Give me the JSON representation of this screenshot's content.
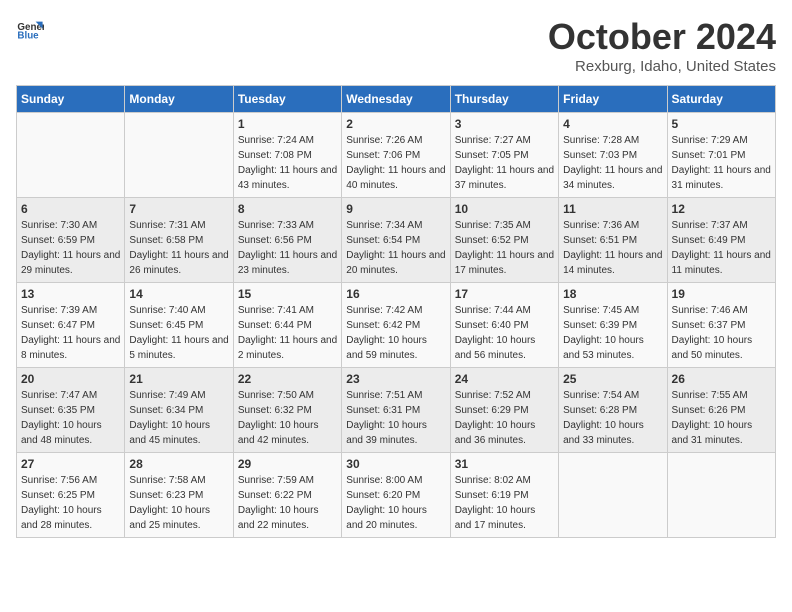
{
  "header": {
    "logo_general": "General",
    "logo_blue": "Blue",
    "month": "October 2024",
    "location": "Rexburg, Idaho, United States"
  },
  "days_of_week": [
    "Sunday",
    "Monday",
    "Tuesday",
    "Wednesday",
    "Thursday",
    "Friday",
    "Saturday"
  ],
  "weeks": [
    [
      {
        "day": "",
        "sunrise": "",
        "sunset": "",
        "daylight": ""
      },
      {
        "day": "",
        "sunrise": "",
        "sunset": "",
        "daylight": ""
      },
      {
        "day": "1",
        "sunrise": "Sunrise: 7:24 AM",
        "sunset": "Sunset: 7:08 PM",
        "daylight": "Daylight: 11 hours and 43 minutes."
      },
      {
        "day": "2",
        "sunrise": "Sunrise: 7:26 AM",
        "sunset": "Sunset: 7:06 PM",
        "daylight": "Daylight: 11 hours and 40 minutes."
      },
      {
        "day": "3",
        "sunrise": "Sunrise: 7:27 AM",
        "sunset": "Sunset: 7:05 PM",
        "daylight": "Daylight: 11 hours and 37 minutes."
      },
      {
        "day": "4",
        "sunrise": "Sunrise: 7:28 AM",
        "sunset": "Sunset: 7:03 PM",
        "daylight": "Daylight: 11 hours and 34 minutes."
      },
      {
        "day": "5",
        "sunrise": "Sunrise: 7:29 AM",
        "sunset": "Sunset: 7:01 PM",
        "daylight": "Daylight: 11 hours and 31 minutes."
      }
    ],
    [
      {
        "day": "6",
        "sunrise": "Sunrise: 7:30 AM",
        "sunset": "Sunset: 6:59 PM",
        "daylight": "Daylight: 11 hours and 29 minutes."
      },
      {
        "day": "7",
        "sunrise": "Sunrise: 7:31 AM",
        "sunset": "Sunset: 6:58 PM",
        "daylight": "Daylight: 11 hours and 26 minutes."
      },
      {
        "day": "8",
        "sunrise": "Sunrise: 7:33 AM",
        "sunset": "Sunset: 6:56 PM",
        "daylight": "Daylight: 11 hours and 23 minutes."
      },
      {
        "day": "9",
        "sunrise": "Sunrise: 7:34 AM",
        "sunset": "Sunset: 6:54 PM",
        "daylight": "Daylight: 11 hours and 20 minutes."
      },
      {
        "day": "10",
        "sunrise": "Sunrise: 7:35 AM",
        "sunset": "Sunset: 6:52 PM",
        "daylight": "Daylight: 11 hours and 17 minutes."
      },
      {
        "day": "11",
        "sunrise": "Sunrise: 7:36 AM",
        "sunset": "Sunset: 6:51 PM",
        "daylight": "Daylight: 11 hours and 14 minutes."
      },
      {
        "day": "12",
        "sunrise": "Sunrise: 7:37 AM",
        "sunset": "Sunset: 6:49 PM",
        "daylight": "Daylight: 11 hours and 11 minutes."
      }
    ],
    [
      {
        "day": "13",
        "sunrise": "Sunrise: 7:39 AM",
        "sunset": "Sunset: 6:47 PM",
        "daylight": "Daylight: 11 hours and 8 minutes."
      },
      {
        "day": "14",
        "sunrise": "Sunrise: 7:40 AM",
        "sunset": "Sunset: 6:45 PM",
        "daylight": "Daylight: 11 hours and 5 minutes."
      },
      {
        "day": "15",
        "sunrise": "Sunrise: 7:41 AM",
        "sunset": "Sunset: 6:44 PM",
        "daylight": "Daylight: 11 hours and 2 minutes."
      },
      {
        "day": "16",
        "sunrise": "Sunrise: 7:42 AM",
        "sunset": "Sunset: 6:42 PM",
        "daylight": "Daylight: 10 hours and 59 minutes."
      },
      {
        "day": "17",
        "sunrise": "Sunrise: 7:44 AM",
        "sunset": "Sunset: 6:40 PM",
        "daylight": "Daylight: 10 hours and 56 minutes."
      },
      {
        "day": "18",
        "sunrise": "Sunrise: 7:45 AM",
        "sunset": "Sunset: 6:39 PM",
        "daylight": "Daylight: 10 hours and 53 minutes."
      },
      {
        "day": "19",
        "sunrise": "Sunrise: 7:46 AM",
        "sunset": "Sunset: 6:37 PM",
        "daylight": "Daylight: 10 hours and 50 minutes."
      }
    ],
    [
      {
        "day": "20",
        "sunrise": "Sunrise: 7:47 AM",
        "sunset": "Sunset: 6:35 PM",
        "daylight": "Daylight: 10 hours and 48 minutes."
      },
      {
        "day": "21",
        "sunrise": "Sunrise: 7:49 AM",
        "sunset": "Sunset: 6:34 PM",
        "daylight": "Daylight: 10 hours and 45 minutes."
      },
      {
        "day": "22",
        "sunrise": "Sunrise: 7:50 AM",
        "sunset": "Sunset: 6:32 PM",
        "daylight": "Daylight: 10 hours and 42 minutes."
      },
      {
        "day": "23",
        "sunrise": "Sunrise: 7:51 AM",
        "sunset": "Sunset: 6:31 PM",
        "daylight": "Daylight: 10 hours and 39 minutes."
      },
      {
        "day": "24",
        "sunrise": "Sunrise: 7:52 AM",
        "sunset": "Sunset: 6:29 PM",
        "daylight": "Daylight: 10 hours and 36 minutes."
      },
      {
        "day": "25",
        "sunrise": "Sunrise: 7:54 AM",
        "sunset": "Sunset: 6:28 PM",
        "daylight": "Daylight: 10 hours and 33 minutes."
      },
      {
        "day": "26",
        "sunrise": "Sunrise: 7:55 AM",
        "sunset": "Sunset: 6:26 PM",
        "daylight": "Daylight: 10 hours and 31 minutes."
      }
    ],
    [
      {
        "day": "27",
        "sunrise": "Sunrise: 7:56 AM",
        "sunset": "Sunset: 6:25 PM",
        "daylight": "Daylight: 10 hours and 28 minutes."
      },
      {
        "day": "28",
        "sunrise": "Sunrise: 7:58 AM",
        "sunset": "Sunset: 6:23 PM",
        "daylight": "Daylight: 10 hours and 25 minutes."
      },
      {
        "day": "29",
        "sunrise": "Sunrise: 7:59 AM",
        "sunset": "Sunset: 6:22 PM",
        "daylight": "Daylight: 10 hours and 22 minutes."
      },
      {
        "day": "30",
        "sunrise": "Sunrise: 8:00 AM",
        "sunset": "Sunset: 6:20 PM",
        "daylight": "Daylight: 10 hours and 20 minutes."
      },
      {
        "day": "31",
        "sunrise": "Sunrise: 8:02 AM",
        "sunset": "Sunset: 6:19 PM",
        "daylight": "Daylight: 10 hours and 17 minutes."
      },
      {
        "day": "",
        "sunrise": "",
        "sunset": "",
        "daylight": ""
      },
      {
        "day": "",
        "sunrise": "",
        "sunset": "",
        "daylight": ""
      }
    ]
  ]
}
